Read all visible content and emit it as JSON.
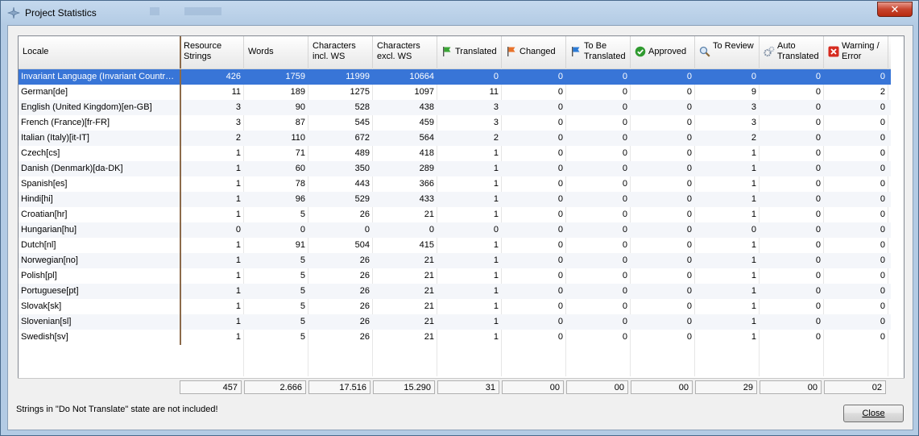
{
  "window": {
    "title": "Project Statistics",
    "close_glyph": "✕"
  },
  "columns": [
    {
      "label": "Locale",
      "icon": null
    },
    {
      "label": "Resource Strings",
      "icon": null
    },
    {
      "label": "Words",
      "icon": null
    },
    {
      "label": "Characters incl. WS",
      "icon": null
    },
    {
      "label": "Characters excl. WS",
      "icon": null
    },
    {
      "label": "Translated",
      "icon": "green-flag-icon",
      "color": "#3aa635"
    },
    {
      "label": "Changed",
      "icon": "orange-flag-icon",
      "color": "#e8722a"
    },
    {
      "label": "To Be Translated",
      "icon": "blue-flag-icon",
      "color": "#2c7bd6"
    },
    {
      "label": "Approved",
      "icon": "check-circle-icon",
      "color": "#2f9a2f"
    },
    {
      "label": "To Review",
      "icon": "magnifier-icon",
      "color": "#5a7fa8"
    },
    {
      "label": "Auto Translated",
      "icon": "gears-icon",
      "color": "#7a8aa0"
    },
    {
      "label": "Warning / Error",
      "icon": "error-x-icon",
      "color": "#d62b1f"
    }
  ],
  "rows": [
    {
      "locale": "Invariant Language (Invariant Countr…",
      "values": [
        "426",
        "1759",
        "11999",
        "10664",
        "0",
        "0",
        "0",
        "0",
        "0",
        "0",
        "0"
      ],
      "selected": true
    },
    {
      "locale": "German[de]",
      "values": [
        "11",
        "189",
        "1275",
        "1097",
        "11",
        "0",
        "0",
        "0",
        "9",
        "0",
        "2"
      ]
    },
    {
      "locale": "English (United Kingdom)[en-GB]",
      "values": [
        "3",
        "90",
        "528",
        "438",
        "3",
        "0",
        "0",
        "0",
        "3",
        "0",
        "0"
      ]
    },
    {
      "locale": "French (France)[fr-FR]",
      "values": [
        "3",
        "87",
        "545",
        "459",
        "3",
        "0",
        "0",
        "0",
        "3",
        "0",
        "0"
      ]
    },
    {
      "locale": "Italian (Italy)[it-IT]",
      "values": [
        "2",
        "110",
        "672",
        "564",
        "2",
        "0",
        "0",
        "0",
        "2",
        "0",
        "0"
      ]
    },
    {
      "locale": "Czech[cs]",
      "values": [
        "1",
        "71",
        "489",
        "418",
        "1",
        "0",
        "0",
        "0",
        "1",
        "0",
        "0"
      ]
    },
    {
      "locale": "Danish (Denmark)[da-DK]",
      "values": [
        "1",
        "60",
        "350",
        "289",
        "1",
        "0",
        "0",
        "0",
        "1",
        "0",
        "0"
      ]
    },
    {
      "locale": "Spanish[es]",
      "values": [
        "1",
        "78",
        "443",
        "366",
        "1",
        "0",
        "0",
        "0",
        "1",
        "0",
        "0"
      ]
    },
    {
      "locale": "Hindi[hi]",
      "values": [
        "1",
        "96",
        "529",
        "433",
        "1",
        "0",
        "0",
        "0",
        "1",
        "0",
        "0"
      ]
    },
    {
      "locale": "Croatian[hr]",
      "values": [
        "1",
        "5",
        "26",
        "21",
        "1",
        "0",
        "0",
        "0",
        "1",
        "0",
        "0"
      ]
    },
    {
      "locale": "Hungarian[hu]",
      "values": [
        "0",
        "0",
        "0",
        "0",
        "0",
        "0",
        "0",
        "0",
        "0",
        "0",
        "0"
      ]
    },
    {
      "locale": "Dutch[nl]",
      "values": [
        "1",
        "91",
        "504",
        "415",
        "1",
        "0",
        "0",
        "0",
        "1",
        "0",
        "0"
      ]
    },
    {
      "locale": "Norwegian[no]",
      "values": [
        "1",
        "5",
        "26",
        "21",
        "1",
        "0",
        "0",
        "0",
        "1",
        "0",
        "0"
      ]
    },
    {
      "locale": "Polish[pl]",
      "values": [
        "1",
        "5",
        "26",
        "21",
        "1",
        "0",
        "0",
        "0",
        "1",
        "0",
        "0"
      ]
    },
    {
      "locale": "Portuguese[pt]",
      "values": [
        "1",
        "5",
        "26",
        "21",
        "1",
        "0",
        "0",
        "0",
        "1",
        "0",
        "0"
      ]
    },
    {
      "locale": "Slovak[sk]",
      "values": [
        "1",
        "5",
        "26",
        "21",
        "1",
        "0",
        "0",
        "0",
        "1",
        "0",
        "0"
      ]
    },
    {
      "locale": "Slovenian[sl]",
      "values": [
        "1",
        "5",
        "26",
        "21",
        "1",
        "0",
        "0",
        "0",
        "1",
        "0",
        "0"
      ]
    },
    {
      "locale": "Swedish[sv]",
      "values": [
        "1",
        "5",
        "26",
        "21",
        "1",
        "0",
        "0",
        "0",
        "1",
        "0",
        "0"
      ]
    }
  ],
  "totals": [
    "457",
    "2.666",
    "17.516",
    "15.290",
    "31",
    "00",
    "00",
    "00",
    "29",
    "00",
    "02"
  ],
  "note": "Strings in \"Do Not Translate\" state are not included!",
  "buttons": {
    "close": "Close"
  },
  "colors": {
    "selection": "#3875d7",
    "locale_divider": "#8b6a4a"
  }
}
